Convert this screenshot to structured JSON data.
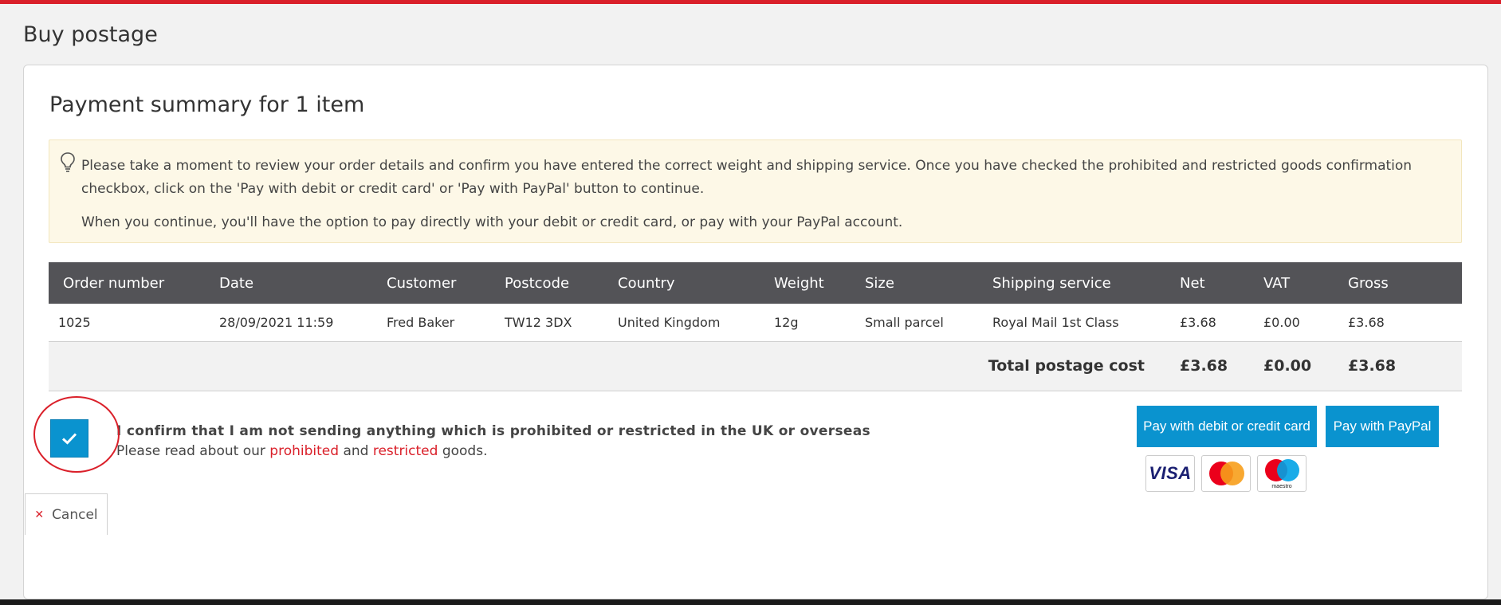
{
  "page": {
    "title": "Buy postage"
  },
  "summary": {
    "title": "Payment summary for 1 item"
  },
  "info": {
    "line1": "Please take a moment to review your order details and confirm you have entered the correct weight and shipping service. Once you have checked the prohibited and restricted goods confirmation checkbox, click on the 'Pay with debit or credit card' or 'Pay with PayPal' button to continue.",
    "line2": "When you continue, you'll have the option to pay directly with your debit or credit card, or pay with your PayPal account."
  },
  "table": {
    "headers": [
      "Order number",
      "Date",
      "Customer",
      "Postcode",
      "Country",
      "Weight",
      "Size",
      "Shipping service",
      "Net",
      "VAT",
      "Gross"
    ],
    "rows": [
      [
        "1025",
        "28/09/2021 11:59",
        "Fred Baker",
        "TW12 3DX",
        "United Kingdom",
        "12g",
        "Small parcel",
        "Royal Mail 1st Class",
        "£3.68",
        "£0.00",
        "£3.68"
      ]
    ],
    "total": {
      "label": "Total postage cost",
      "net": "£3.68",
      "vat": "£0.00",
      "gross": "£3.68"
    }
  },
  "confirm": {
    "checked": true,
    "title": "I confirm that I am not sending anything which is prohibited or restricted in the UK or overseas",
    "sub_prefix": "Please read about our",
    "prohibited_link": "prohibited",
    "and_text": "and",
    "restricted_link": "restricted",
    "sub_suffix": "goods."
  },
  "buttons": {
    "pay_card": "Pay with debit or credit card",
    "pay_paypal": "Pay with PayPal",
    "cancel": "Cancel"
  },
  "card_logos": {
    "visa": "VISA",
    "maestro": "maestro"
  },
  "colors": {
    "brand_red": "#da202a",
    "button_blue": "#0a93cf",
    "table_header": "#535357",
    "info_bg": "#fdf8e7"
  }
}
